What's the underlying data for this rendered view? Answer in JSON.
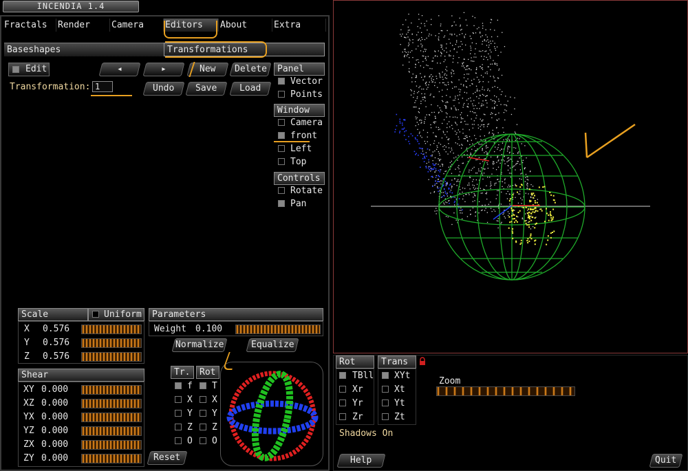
{
  "app": {
    "title": "INCENDIA 1.4"
  },
  "menu": {
    "tabs": [
      "Fractals",
      "Render",
      "Camera",
      "Editors",
      "About",
      "Extra"
    ]
  },
  "subtabs": {
    "baseshapes": "Baseshapes",
    "transformations": "Transformations"
  },
  "editor": {
    "edit_label": "Edit",
    "prev_icon": "◂",
    "next_icon": "▸",
    "new_label": "New",
    "delete_label": "Delete",
    "undo_label": "Undo",
    "save_label": "Save",
    "load_label": "Load",
    "transformation_label": "Transformation:",
    "transformation_value": "1"
  },
  "panel": {
    "header": "Panel",
    "options": [
      "Vector",
      "Points"
    ]
  },
  "window": {
    "header": "Window",
    "options": [
      "Camera",
      "front",
      "Left",
      "Top"
    ]
  },
  "controls": {
    "header": "Controls",
    "options": [
      "Rotate",
      "Pan"
    ]
  },
  "scale": {
    "header": "Scale",
    "uniform_label": "Uniform",
    "rows": [
      {
        "label": "X",
        "value": "0.576"
      },
      {
        "label": "Y",
        "value": "0.576"
      },
      {
        "label": "Z",
        "value": "0.576"
      }
    ]
  },
  "shear": {
    "header": "Shear",
    "rows": [
      {
        "label": "XY",
        "value": "0.000"
      },
      {
        "label": "XZ",
        "value": "0.000"
      },
      {
        "label": "YX",
        "value": "0.000"
      },
      {
        "label": "YZ",
        "value": "0.000"
      },
      {
        "label": "ZX",
        "value": "0.000"
      },
      {
        "label": "ZY",
        "value": "0.000"
      }
    ]
  },
  "parameters": {
    "header": "Parameters",
    "weight_label": "Weight",
    "weight_value": "0.100",
    "normalize_label": "Normalize",
    "equalize_label": "Equalize"
  },
  "trrot": {
    "tr_label": "Tr.",
    "rot_label": "Rot",
    "tr_items": [
      "f",
      "X",
      "Y",
      "Z",
      "O"
    ],
    "rot_items": [
      "T",
      "X",
      "Y",
      "Z",
      "O"
    ],
    "reset_label": "Reset"
  },
  "viewctl": {
    "rot_header": "Rot",
    "trans_header": "Trans",
    "rot_items": [
      "TBll",
      "Xr",
      "Yr",
      "Zr"
    ],
    "trans_items": [
      "XYt",
      "Xt",
      "Yt",
      "Zt"
    ],
    "shadows_label": "Shadows On",
    "zoom_label": "Zoom",
    "lock_icon": "lock-icon"
  },
  "footer": {
    "help_label": "Help",
    "quit_label": "Quit"
  },
  "colors": {
    "accent": "#ff9a20",
    "annotation": "#e8a020",
    "sphere": "#1faa2a",
    "points": "#d8d8d8",
    "yellow": "#f0f040",
    "frame_red": "#8a3a3a"
  }
}
